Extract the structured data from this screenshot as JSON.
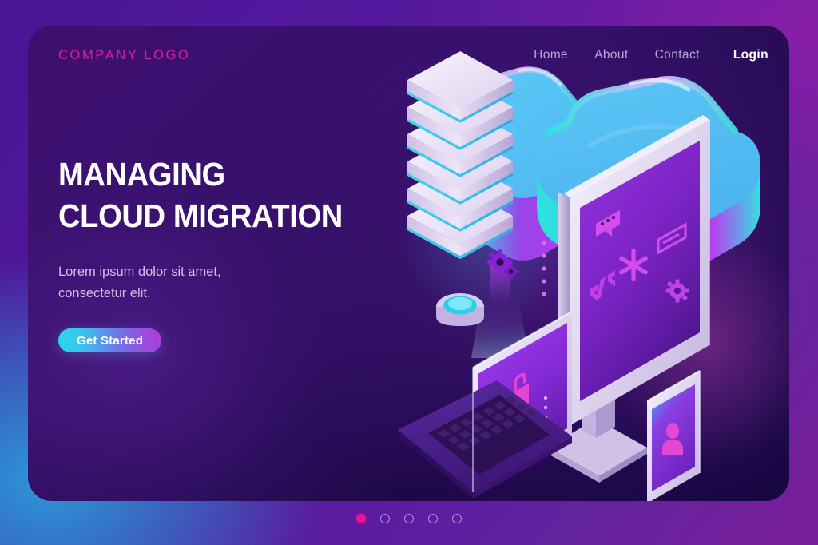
{
  "brand": {
    "logo_text": "COMPANY LOGO",
    "logo_color": "#d4219a"
  },
  "nav": {
    "items": [
      {
        "label": "Home",
        "name": "nav-link-home"
      },
      {
        "label": "About",
        "name": "nav-link-about"
      },
      {
        "label": "Contact",
        "name": "nav-link-contact"
      }
    ],
    "login_label": "Login",
    "link_color": "#b9a5da",
    "login_color": "#ffffff"
  },
  "hero": {
    "headline_line1": "MANAGING",
    "headline_line2": "CLOUD MIGRATION",
    "subtitle_line1": "Lorem ipsum dolor sit amet,",
    "subtitle_line2": "consectetur elit.",
    "cta_label": "Get Started",
    "cta_gradient_from": "#2fd4e8",
    "cta_gradient_to": "#a93ddb",
    "headline_color": "#ffffff",
    "subtitle_color": "#cfc0e8"
  },
  "carousel": {
    "total": 5,
    "active_index": 0,
    "active_color": "#e31596",
    "inactive_color": "#c4b2e2"
  },
  "illustration": {
    "alt": "isometric cloud migration illustration",
    "elements": [
      {
        "name": "cloud-large",
        "label": "cloud"
      },
      {
        "name": "cloud-small",
        "label": "cloud"
      },
      {
        "name": "server-stack",
        "label": "server rack"
      },
      {
        "name": "laptop",
        "label": "laptop"
      },
      {
        "name": "desktop-monitor",
        "label": "monitor"
      },
      {
        "name": "smartphone",
        "label": "smartphone"
      }
    ],
    "floating_icons": [
      "gear-icon",
      "envelope-icon",
      "bar-chart-icon",
      "folder-icon",
      "chat-bubble-icon",
      "code-brackets-icon",
      "asterisk-icon",
      "credit-card-icon",
      "gear-icon",
      "lock-icon",
      "user-avatar-icon"
    ],
    "palette": {
      "cloud_top": "#5ac8f5",
      "cloud_edge_cyan": "#2ce0e0",
      "cloud_edge_purple": "#a23cf0",
      "device_frame": "#e8e0f4",
      "screen_purple": "#8b2fd6",
      "accent_magenta": "#e040c8"
    }
  },
  "background": {
    "outer_from": "#4a1495",
    "outer_to": "#7a1e9a",
    "outer_blue_glow": "#28a0dc",
    "card_from": "#3f0f6e",
    "card_to": "#160741"
  }
}
